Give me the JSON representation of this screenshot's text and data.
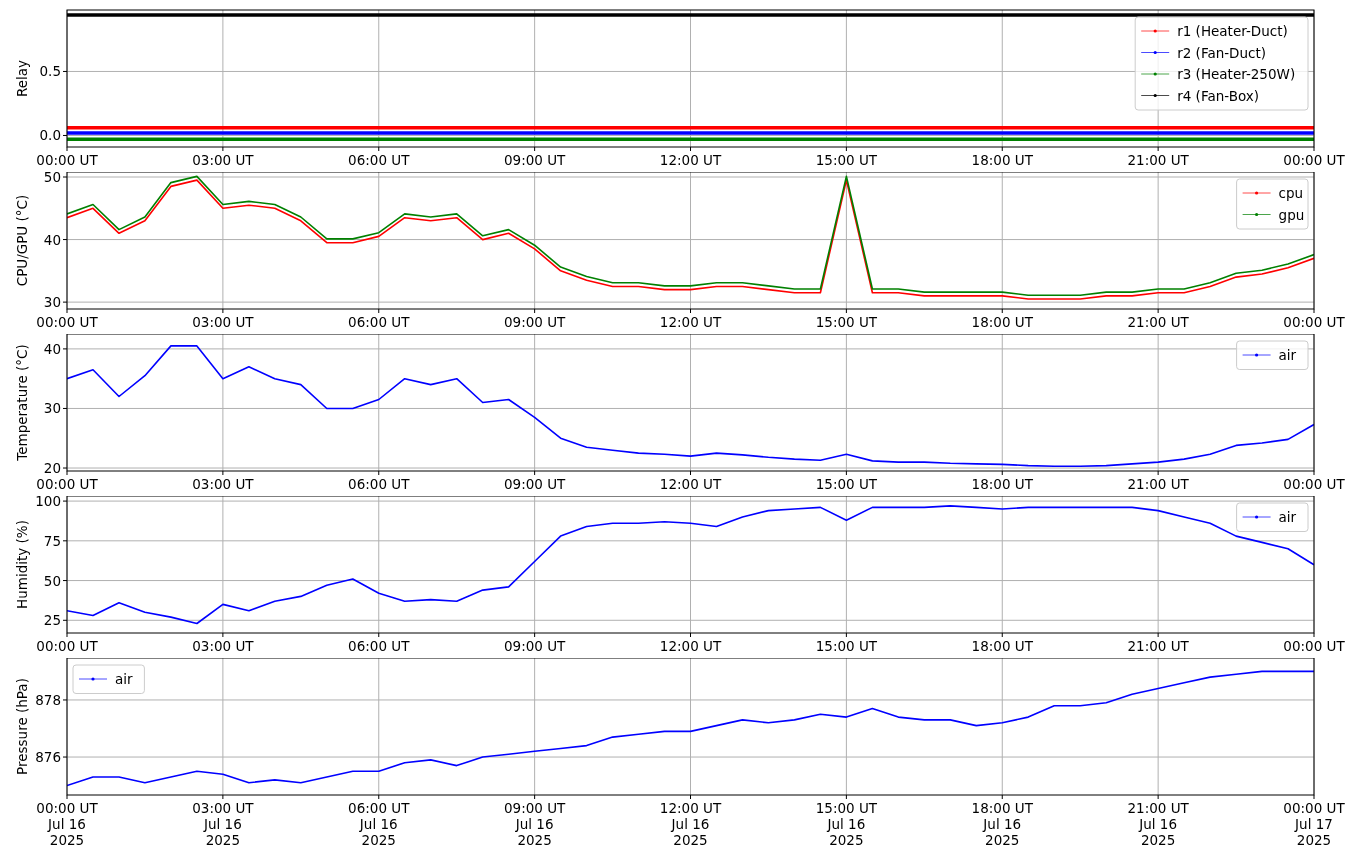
{
  "panels": [
    {
      "chart_data": {
        "type": "line",
        "grid": true,
        "legend": "upper right",
        "ylabel": "Relay",
        "ylim": [
          -0.09,
          0.98
        ],
        "yticks": [
          {
            "value": 0,
            "label": "0.0"
          },
          {
            "value": 0.5,
            "label": "0.5"
          }
        ],
        "categories": [
          "00:00 UT",
          "03:00 UT",
          "06:00 UT",
          "09:00 UT",
          "12:00 UT",
          "15:00 UT",
          "18:00 UT",
          "21:00 UT",
          "00:00 UT"
        ],
        "series": [
          {
            "name": "r1 (Heater-Duct)",
            "color": "#ff0000",
            "values": [
              0.06,
              0.06,
              0.06,
              0.06,
              0.06,
              0.06,
              0.06,
              0.06,
              0.06
            ]
          },
          {
            "name": "r2 (Fan-Duct)",
            "color": "#0000ff",
            "values": [
              0.02,
              0.02,
              0.02,
              0.02,
              0.02,
              0.02,
              0.02,
              0.02,
              0.02
            ]
          },
          {
            "name": "r3 (Heater-250W)",
            "color": "#008000",
            "values": [
              -0.03,
              -0.03,
              -0.03,
              -0.03,
              -0.03,
              -0.03,
              -0.03,
              -0.03,
              -0.03
            ]
          },
          {
            "name": "r4 (Fan-Box)",
            "color": "#000000",
            "values": [
              0.94,
              0.94,
              0.94,
              0.94,
              0.94,
              0.94,
              0.94,
              0.94,
              0.94
            ]
          }
        ]
      }
    },
    {
      "chart_data": {
        "type": "line",
        "grid": true,
        "legend": "upper right",
        "ylabel": "CPU/GPU (°C)",
        "ylim": [
          28.9,
          50.8
        ],
        "yticks": [
          30,
          40,
          50
        ],
        "categories": [
          "00:00 UT",
          null,
          null,
          null,
          null,
          null,
          "03:00 UT",
          null,
          null,
          null,
          null,
          null,
          "06:00 UT",
          null,
          null,
          null,
          null,
          null,
          "09:00 UT",
          null,
          null,
          null,
          null,
          null,
          "12:00 UT",
          null,
          null,
          null,
          null,
          null,
          "15:00 UT",
          null,
          null,
          null,
          null,
          null,
          "18:00 UT",
          null,
          null,
          null,
          null,
          null,
          "21:00 UT",
          null,
          null,
          null,
          null,
          null,
          "00:00 UT"
        ],
        "series": [
          {
            "name": "cpu",
            "color": "#ff0000",
            "values": [
              43.5,
              45,
              41,
              43,
              48.5,
              49.5,
              45,
              45.5,
              45,
              43,
              39.5,
              39.5,
              40.5,
              43.5,
              43,
              43.5,
              40,
              41,
              38.5,
              35,
              33.5,
              32.5,
              32.5,
              32,
              32,
              32.5,
              32.5,
              32,
              31.5,
              31.5,
              49.5,
              31.5,
              31.5,
              31,
              31,
              31,
              31,
              30.5,
              30.5,
              30.5,
              31,
              31,
              31.5,
              31.5,
              32.5,
              34,
              34.5,
              35.5,
              37
            ]
          },
          {
            "name": "gpu",
            "color": "#008000",
            "values": [
              44.1,
              45.6,
              41.6,
              43.6,
              49.1,
              50.1,
              45.6,
              46.1,
              45.6,
              43.6,
              40.1,
              40.1,
              41.1,
              44.1,
              43.6,
              44.1,
              40.6,
              41.6,
              39.1,
              35.6,
              34.1,
              33.1,
              33.1,
              32.6,
              32.6,
              33.1,
              33.1,
              32.6,
              32.1,
              32.1,
              50.1,
              32.1,
              32.1,
              31.6,
              31.6,
              31.6,
              31.6,
              31.1,
              31.1,
              31.1,
              31.6,
              31.6,
              32.1,
              32.1,
              33.1,
              34.6,
              35.1,
              36.1,
              37.6
            ]
          }
        ]
      }
    },
    {
      "chart_data": {
        "type": "line",
        "grid": true,
        "legend": "upper right",
        "ylabel": "Temperature (°C)",
        "ylim": [
          19.5,
          42.5
        ],
        "yticks": [
          20,
          30,
          40
        ],
        "categories": [
          "00:00 UT",
          null,
          null,
          null,
          null,
          null,
          "03:00 UT",
          null,
          null,
          null,
          null,
          null,
          "06:00 UT",
          null,
          null,
          null,
          null,
          null,
          "09:00 UT",
          null,
          null,
          null,
          null,
          null,
          "12:00 UT",
          null,
          null,
          null,
          null,
          null,
          "15:00 UT",
          null,
          null,
          null,
          null,
          null,
          "18:00 UT",
          null,
          null,
          null,
          null,
          null,
          "21:00 UT",
          null,
          null,
          null,
          null,
          null,
          "00:00 UT"
        ],
        "series": [
          {
            "name": "air",
            "color": "#0000ff",
            "values": [
              35,
              36.5,
              32,
              35.5,
              40.5,
              40.5,
              35,
              37,
              35,
              34,
              30,
              30,
              31.5,
              35,
              34,
              35,
              31,
              31.5,
              28.5,
              25,
              23.5,
              23,
              22.5,
              22.3,
              22,
              22.5,
              22.2,
              21.8,
              21.5,
              21.3,
              22.3,
              21.2,
              21,
              21,
              20.8,
              20.7,
              20.6,
              20.4,
              20.3,
              20.3,
              20.4,
              20.7,
              21,
              21.5,
              22.3,
              23.8,
              24.2,
              24.8,
              27.3
            ]
          }
        ]
      }
    },
    {
      "chart_data": {
        "type": "line",
        "grid": true,
        "legend": "upper right",
        "ylabel": "Humidity (%)",
        "ylim": [
          17,
          103.2
        ],
        "yticks": [
          25,
          50,
          75,
          100
        ],
        "categories": [
          "00:00 UT",
          null,
          null,
          null,
          null,
          null,
          "03:00 UT",
          null,
          null,
          null,
          null,
          null,
          "06:00 UT",
          null,
          null,
          null,
          null,
          null,
          "09:00 UT",
          null,
          null,
          null,
          null,
          null,
          "12:00 UT",
          null,
          null,
          null,
          null,
          null,
          "15:00 UT",
          null,
          null,
          null,
          null,
          null,
          "18:00 UT",
          null,
          null,
          null,
          null,
          null,
          "21:00 UT",
          null,
          null,
          null,
          null,
          null,
          "00:00 UT"
        ],
        "series": [
          {
            "name": "air",
            "color": "#0000ff",
            "values": [
              31,
              28,
              36,
              30,
              27,
              23,
              35,
              31,
              37,
              40,
              47,
              51,
              42,
              37,
              38,
              37,
              44,
              46,
              62,
              78,
              84,
              86,
              86,
              87,
              86,
              84,
              90,
              94,
              95,
              96,
              88,
              96,
              96,
              96,
              97,
              96,
              95,
              96,
              96,
              96,
              96,
              96,
              94,
              90,
              86,
              78,
              74,
              70,
              60
            ]
          }
        ]
      }
    },
    {
      "chart_data": {
        "type": "line",
        "grid": true,
        "legend": "upper left",
        "ylabel": "Pressure (hPa)",
        "ylim": [
          874.67,
          879.47
        ],
        "yticks": [
          876,
          878
        ],
        "categories": [
          "00:00 UT\nJul 16\n2025",
          null,
          null,
          null,
          null,
          null,
          "03:00 UT\nJul 16\n2025",
          null,
          null,
          null,
          null,
          null,
          "06:00 UT\nJul 16\n2025",
          null,
          null,
          null,
          null,
          null,
          "09:00 UT\nJul 16\n2025",
          null,
          null,
          null,
          null,
          null,
          "12:00 UT\nJul 16\n2025",
          null,
          null,
          null,
          null,
          null,
          "15:00 UT\nJul 16\n2025",
          null,
          null,
          null,
          null,
          null,
          "18:00 UT\nJul 16\n2025",
          null,
          null,
          null,
          null,
          null,
          "21:00 UT\nJul 16\n2025",
          null,
          null,
          null,
          null,
          null,
          "00:00 UT\nJul 17\n2025"
        ],
        "series": [
          {
            "name": "air",
            "color": "#0000ff",
            "values": [
              875,
              875.3,
              875.3,
              875.1,
              875.3,
              875.5,
              875.4,
              875.1,
              875.2,
              875.1,
              875.3,
              875.5,
              875.5,
              875.8,
              875.9,
              875.7,
              876,
              876.1,
              876.2,
              876.3,
              876.4,
              876.7,
              876.8,
              876.9,
              876.9,
              877.1,
              877.3,
              877.2,
              877.3,
              877.5,
              877.4,
              877.7,
              877.4,
              877.3,
              877.3,
              877.1,
              877.2,
              877.4,
              877.8,
              877.8,
              877.9,
              878.2,
              878.4,
              878.6,
              878.8,
              878.9,
              879,
              879,
              879
            ]
          }
        ]
      }
    }
  ]
}
